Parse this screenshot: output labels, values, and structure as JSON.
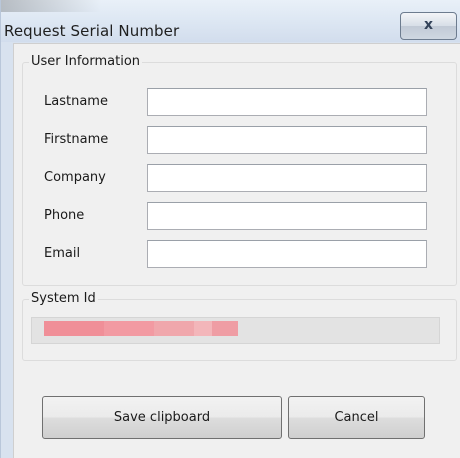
{
  "window": {
    "title": "Request Serial Number",
    "close_label": "x"
  },
  "user_info": {
    "legend": "User Information",
    "fields": [
      {
        "label": "Lastname",
        "value": ""
      },
      {
        "label": "Firstname",
        "value": ""
      },
      {
        "label": "Company",
        "value": ""
      },
      {
        "label": "Phone",
        "value": ""
      },
      {
        "label": "Email",
        "value": ""
      }
    ]
  },
  "system_id": {
    "legend": "System Id",
    "value_redacted": true,
    "redaction_color": "#f0a0a6"
  },
  "buttons": {
    "save_label": "Save clipboard",
    "cancel_label": "Cancel"
  }
}
